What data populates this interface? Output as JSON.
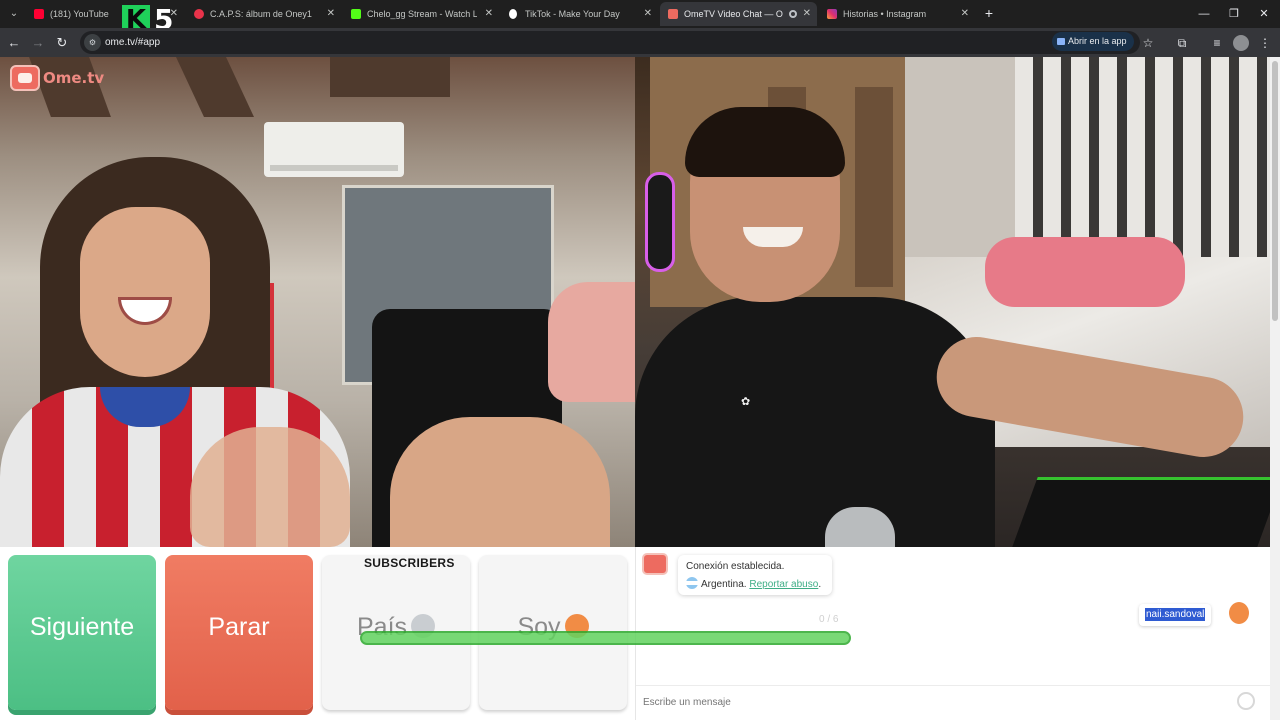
{
  "browser": {
    "tabs": [
      {
        "title": "(181) YouTube",
        "favicon": "youtube-icon",
        "color": "#ff0033"
      },
      {
        "title": "C.A.P.S: álbum de Oney1",
        "favicon": "vinyl-icon",
        "color": "#e8334a"
      },
      {
        "title": "Chelo_gg Stream - Watch Live o",
        "favicon": "kick-icon",
        "color": "#53fc18"
      },
      {
        "title": "TikTok - Make Your Day",
        "favicon": "tiktok-icon",
        "color": "#ffffff"
      },
      {
        "title": "OmeTV Video Chat — Ome",
        "favicon": "ometv-icon",
        "color": "#ed6b60",
        "active": true
      },
      {
        "title": "Historias • Instagram",
        "favicon": "instagram-icon",
        "color": "#e1306c"
      }
    ],
    "url": "ome.tv/#app",
    "open_in_app": "Abrir en la app",
    "overlay_badge": {
      "letter": "K",
      "number": "5"
    }
  },
  "app": {
    "logo_name": "Ome.tv"
  },
  "controls": {
    "next_label": "Siguiente",
    "stop_label": "Parar",
    "country_label": "País",
    "gender_label": "Soy"
  },
  "chat": {
    "system_line1": "Conexión establecida.",
    "country": "Argentina.",
    "report_link": "Reportar abuso",
    "counter": "0 / 6",
    "username": "naii.sandoval",
    "input_placeholder": "Escribe un mensaje"
  },
  "overlay": {
    "subscribers_label": "SUBSCRIBERS"
  },
  "colors": {
    "next": "#4cbf84",
    "stop": "#e2614a",
    "brand": "#ed6b60",
    "link": "#3fae86"
  }
}
